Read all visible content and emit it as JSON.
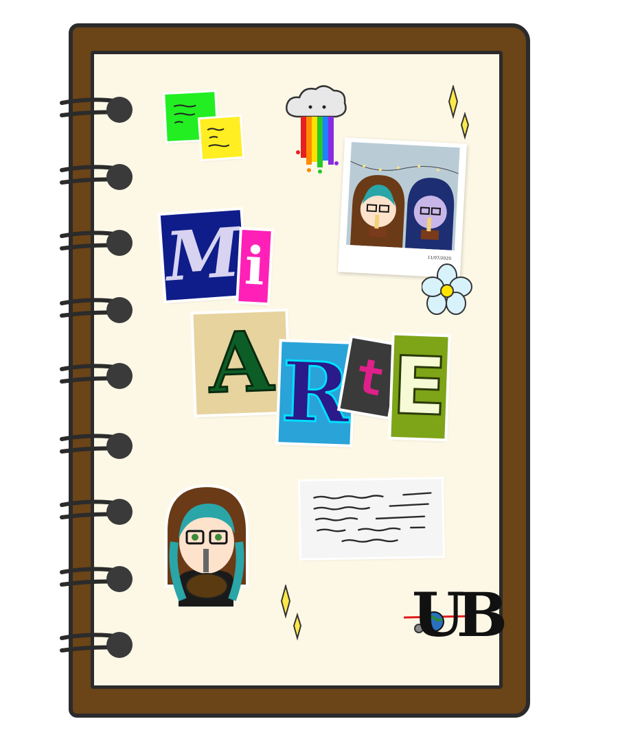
{
  "title": {
    "word1": [
      "M",
      "i"
    ],
    "word2": [
      "A",
      "R",
      "t",
      "E"
    ]
  },
  "polaroid": {
    "date": "11/07/2020"
  },
  "logo": {
    "text": "UB"
  },
  "colors": {
    "cover": "#6b4417",
    "page": "#fdf8e6",
    "outline": "#2b2b2b"
  }
}
